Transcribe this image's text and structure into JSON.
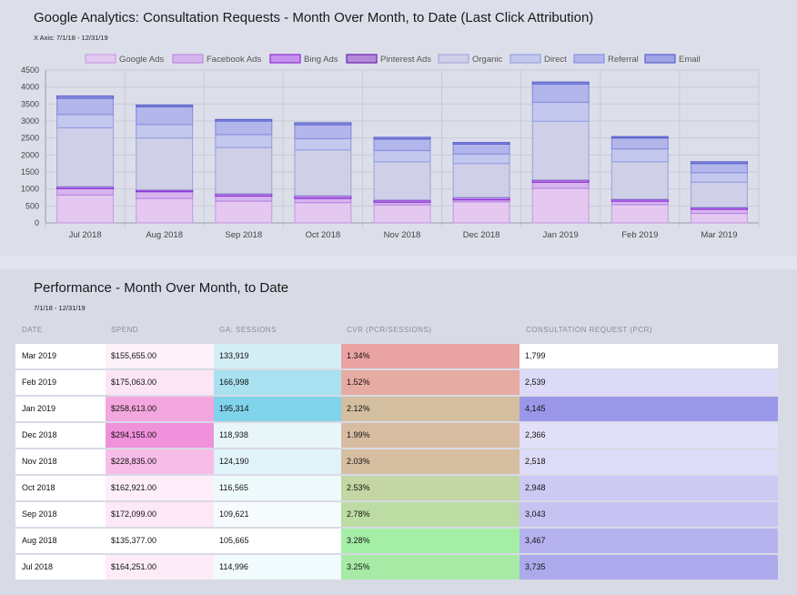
{
  "chart": {
    "title": "Google Analytics: Consultation Requests - Month Over Month, to Date (Last Click Attribution)",
    "subtitle": "X Axis: 7/1/18 - 12/31/19"
  },
  "chart_data": {
    "type": "bar",
    "stacked": true,
    "title": "Google Analytics: Consultation Requests - Month Over Month, to Date (Last Click Attribution)",
    "subtitle": "X Axis: 7/1/18 - 12/31/19",
    "xlabel": "",
    "ylabel": "",
    "ylim": [
      0,
      4500
    ],
    "yticks": [
      0,
      500,
      1000,
      1500,
      2000,
      2500,
      3000,
      3500,
      4000,
      4500
    ],
    "grid": true,
    "legend_position": "top",
    "categories": [
      "Jul 2018",
      "Aug 2018",
      "Sep 2018",
      "Oct 2018",
      "Nov 2018",
      "Dec 2018",
      "Jan 2019",
      "Feb 2019",
      "Mar 2019"
    ],
    "series": [
      {
        "name": "Google Ads",
        "color": "#e4c8f0",
        "border": "#c9a0e6",
        "values": [
          820,
          720,
          640,
          600,
          530,
          620,
          1020,
          540,
          280
        ]
      },
      {
        "name": "Facebook Ads",
        "color": "#d8b4ee",
        "border": "#b98ae0",
        "values": [
          190,
          200,
          150,
          120,
          80,
          60,
          180,
          100,
          120
        ]
      },
      {
        "name": "Bing Ads",
        "color": "#c690ef",
        "border": "#8c2ed6",
        "values": [
          50,
          50,
          60,
          70,
          60,
          60,
          60,
          50,
          50
        ]
      },
      {
        "name": "Pinterest Ads",
        "color": "#b48ad8",
        "border": "#6a1fb0",
        "values": [
          10,
          10,
          10,
          10,
          10,
          10,
          10,
          10,
          10
        ]
      },
      {
        "name": "Organic",
        "color": "#cfcfe8",
        "border": "#a8a8da",
        "values": [
          1730,
          1520,
          1360,
          1350,
          1120,
          1000,
          1720,
          1100,
          740
        ]
      },
      {
        "name": "Direct",
        "color": "#c4c8ee",
        "border": "#9aa2e2",
        "values": [
          390,
          400,
          380,
          330,
          330,
          280,
          560,
          380,
          280
        ]
      },
      {
        "name": "Referral",
        "color": "#b3b6ea",
        "border": "#8a90de",
        "values": [
          480,
          520,
          400,
          410,
          340,
          290,
          540,
          320,
          270
        ]
      },
      {
        "name": "Email",
        "color": "#9ea3e6",
        "border": "#5a61cc",
        "values": [
          65,
          47,
          43,
          58,
          48,
          46,
          55,
          39,
          49
        ]
      }
    ]
  },
  "table": {
    "title": "Performance - Month Over Month, to Date",
    "subtitle": "7/1/18 - 12/31/19",
    "headers": {
      "date": "DATE",
      "spend": "SPEND",
      "sessions": "GA: SESSIONS",
      "cvr": "CVR (PCR/SESSIONS)",
      "pcr": "CONSULTATION REQUEST (PCR)"
    },
    "rows": [
      {
        "date": "Mar 2019",
        "spend": "$155,655.00",
        "sessions": "133,919",
        "cvr": "1.34%",
        "pcr": "1,799",
        "spend_color": "#fdf2fa",
        "sessions_color": "#d4eef6",
        "cvr_color": "#eaa3a3",
        "pcr_color": "#ffffff"
      },
      {
        "date": "Feb 2019",
        "spend": "$175,063.00",
        "sessions": "166,998",
        "cvr": "1.52%",
        "pcr": "2,539",
        "spend_color": "#fce6f5",
        "sessions_color": "#a9e1f0",
        "cvr_color": "#e6aba2",
        "pcr_color": "#dcdaf6"
      },
      {
        "date": "Jan 2019",
        "spend": "$258,613.00",
        "sessions": "195,314",
        "cvr": "2.12%",
        "pcr": "4,145",
        "spend_color": "#f4a7de",
        "sessions_color": "#7fd3eb",
        "cvr_color": "#d4bea0",
        "pcr_color": "#9b97e8"
      },
      {
        "date": "Dec 2018",
        "spend": "$294,155.00",
        "sessions": "118,938",
        "cvr": "1.99%",
        "pcr": "2,366",
        "spend_color": "#f091db",
        "sessions_color": "#e8f6fa",
        "cvr_color": "#d8bca1",
        "pcr_color": "#e2e0f8"
      },
      {
        "date": "Nov 2018",
        "spend": "$228,835.00",
        "sessions": "124,190",
        "cvr": "2.03%",
        "pcr": "2,518",
        "spend_color": "#f7bde8",
        "sessions_color": "#e0f3f8",
        "cvr_color": "#d6bea1",
        "pcr_color": "#dddbf7"
      },
      {
        "date": "Oct 2018",
        "spend": "$162,921.00",
        "sessions": "116,565",
        "cvr": "2.53%",
        "pcr": "2,948",
        "spend_color": "#fdeef9",
        "sessions_color": "#eef9fb",
        "cvr_color": "#c4d6a3",
        "pcr_color": "#ccc9f3"
      },
      {
        "date": "Sep 2018",
        "spend": "$172,099.00",
        "sessions": "109,621",
        "cvr": "2.78%",
        "pcr": "3,043",
        "spend_color": "#fce8f6",
        "sessions_color": "#f6fcfd",
        "cvr_color": "#bcdca4",
        "pcr_color": "#c6c3f2"
      },
      {
        "date": "Aug 2018",
        "spend": "$135,377.00",
        "sessions": "105,665",
        "cvr": "3.28%",
        "pcr": "3,467",
        "spend_color": "#ffffff",
        "sessions_color": "#ffffff",
        "cvr_color": "#a4eea6",
        "pcr_color": "#b6b2ef"
      },
      {
        "date": "Jul 2018",
        "spend": "$164,251.00",
        "sessions": "114,996",
        "cvr": "3.25%",
        "pcr": "3,735",
        "spend_color": "#fdecf8",
        "sessions_color": "#f1fafc",
        "cvr_color": "#a6eaa6",
        "pcr_color": "#ada9ed"
      }
    ]
  }
}
